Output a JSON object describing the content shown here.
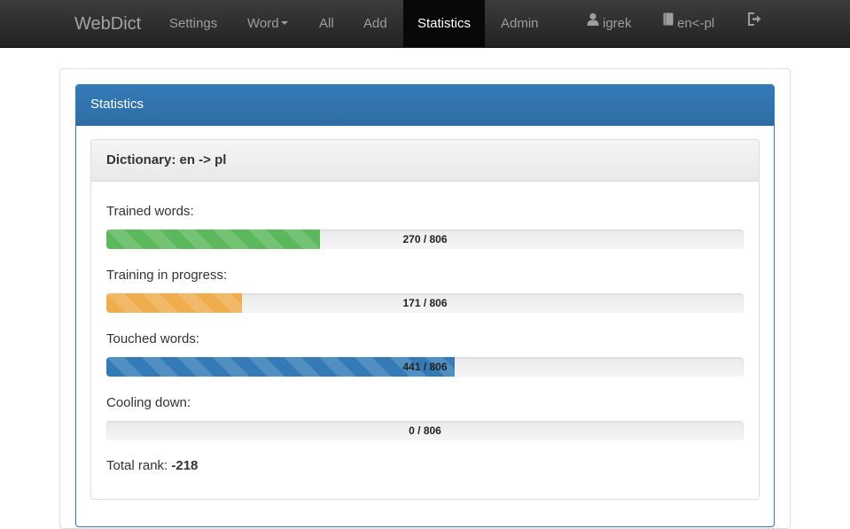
{
  "navbar": {
    "brand": "WebDict",
    "items": [
      {
        "label": "Settings"
      },
      {
        "label": "Word"
      },
      {
        "label": "All"
      },
      {
        "label": "Add"
      },
      {
        "label": "Statistics",
        "active": true
      },
      {
        "label": "Admin"
      }
    ],
    "user": "igrek",
    "dictionary": "en<-pl",
    "icons": {
      "user": "user-icon",
      "dictionary": "book-icon",
      "logout": "logout-icon"
    }
  },
  "panel": {
    "title": "Statistics"
  },
  "dictionary": {
    "heading": "Dictionary: en -> pl"
  },
  "stats": [
    {
      "label": "Trained words:",
      "value": 270,
      "total": 806,
      "text": "270 / 806",
      "color": "#5cb85c"
    },
    {
      "label": "Training in progress:",
      "value": 171,
      "total": 806,
      "text": "171 / 806",
      "color": "#f0ad4e"
    },
    {
      "label": "Touched words:",
      "value": 441,
      "total": 806,
      "text": "441 / 806",
      "color": "#337ab7"
    },
    {
      "label": "Cooling down:",
      "value": 0,
      "total": 806,
      "text": "0 / 806",
      "color": "#cccccc"
    }
  ],
  "total_rank": {
    "label": "Total rank:",
    "value": "-218"
  }
}
